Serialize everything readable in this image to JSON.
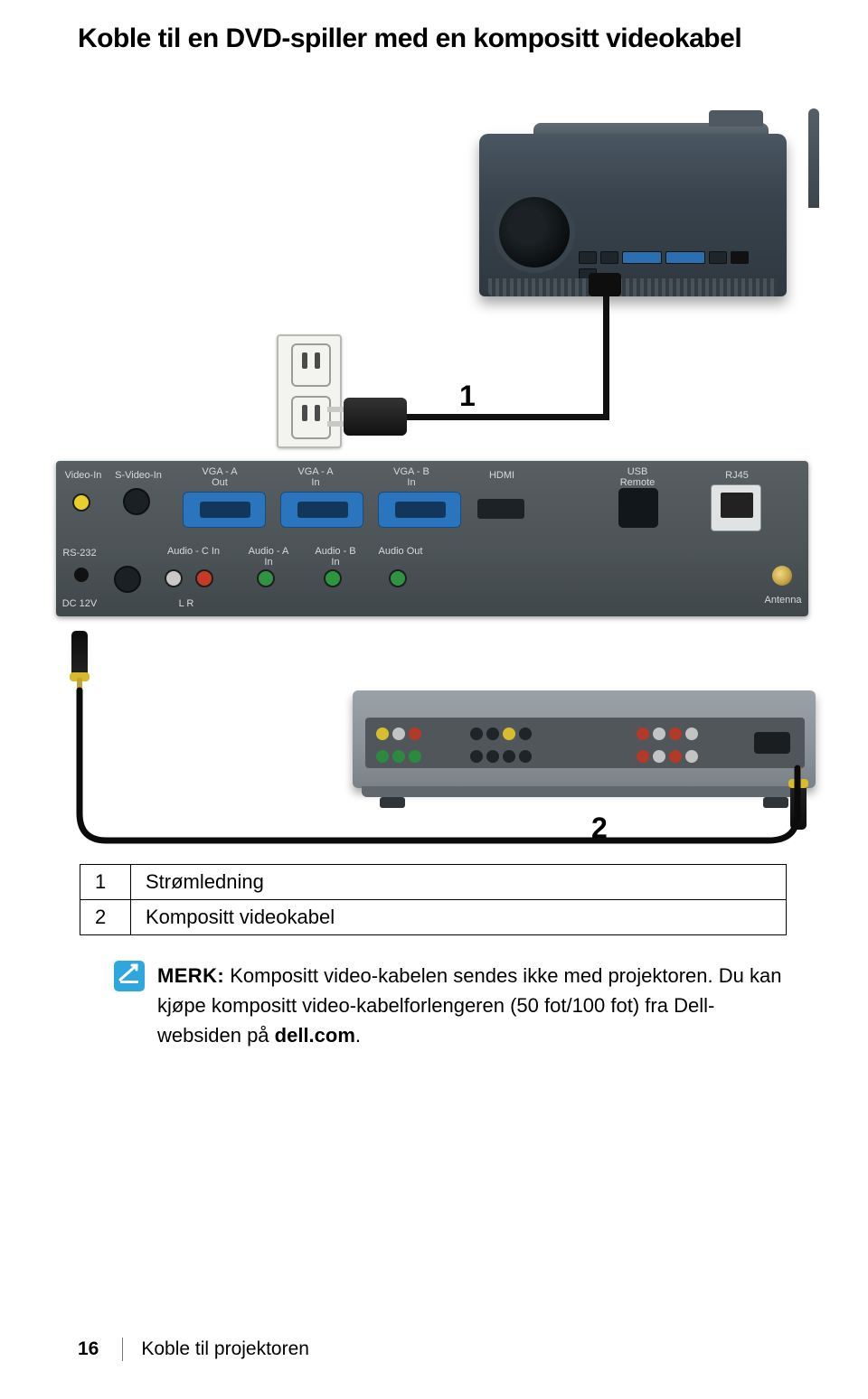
{
  "title": "Koble til en DVD-spiller med en kompositt videokabel",
  "diagram": {
    "label1": "1",
    "label2": "2",
    "panel_labels": {
      "video_in": "Video-In",
      "svideo_in": "S-Video-In",
      "vga_a_out": "VGA - A\nOut",
      "vga_a_in": "VGA - A\nIn",
      "vga_b_in": "VGA - B\nIn",
      "hdmi": "HDMI",
      "usb_remote": "USB\nRemote",
      "rj45": "RJ45",
      "rs232": "RS-232",
      "dc12v": "DC 12V",
      "audio_c_in": "Audio - C In",
      "audio_a_in": "Audio - A\nIn",
      "audio_b_in": "Audio - B\nIn",
      "audio_out": "Audio Out",
      "lr": "L    R",
      "antenna": "Antenna"
    }
  },
  "legend": [
    {
      "num": "1",
      "text": "Strømledning"
    },
    {
      "num": "2",
      "text": "Kompositt videokabel"
    }
  ],
  "note": {
    "prefix": "MERK:",
    "body_a": " Kompositt video-kabelen sendes ikke med projektoren. Du kan kjøpe kompositt video-kabelforlengeren (50 fot/100 fot) fra Dell-websiden på ",
    "bold_tail": "dell.com",
    "period": "."
  },
  "footer": {
    "page": "16",
    "section": "Koble til projektoren"
  }
}
